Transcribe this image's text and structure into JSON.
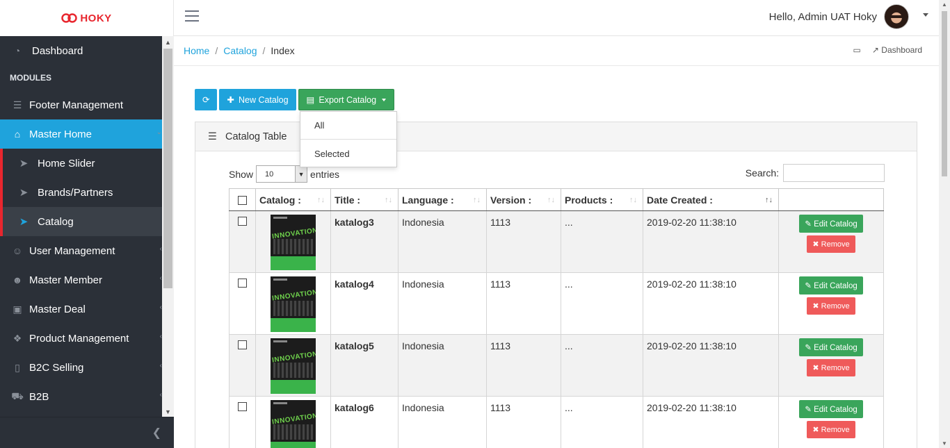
{
  "brand": {
    "name": "HOKY",
    "color": "#e8262e"
  },
  "header": {
    "greeting": "Hello, Admin UAT Hoky"
  },
  "sidebar": {
    "dashboard": "Dashboard",
    "section": "MODULES",
    "items": [
      {
        "label": "Footer Management",
        "icon": "list-icon"
      },
      {
        "label": "Master Home",
        "icon": "home-icon",
        "active": true
      },
      {
        "label": "User Management",
        "icon": "users-icon"
      },
      {
        "label": "Master Member",
        "icon": "group-icon"
      },
      {
        "label": "Master Deal",
        "icon": "money-icon"
      },
      {
        "label": "Product Management",
        "icon": "cubes-icon"
      },
      {
        "label": "B2C Selling",
        "icon": "mobile-icon"
      },
      {
        "label": "B2B",
        "icon": "cart-icon"
      }
    ],
    "subitems": [
      {
        "label": "Home Slider"
      },
      {
        "label": "Brands/Partners"
      },
      {
        "label": "Catalog",
        "selected": true
      }
    ]
  },
  "breadcrumb": {
    "home": "Home",
    "catalog": "Catalog",
    "current": "Index"
  },
  "topright": {
    "dashboard": "Dashboard"
  },
  "toolbar": {
    "new_label": "New Catalog",
    "export_label": "Export Catalog"
  },
  "export_menu": {
    "all": "All",
    "selected": "Selected"
  },
  "card": {
    "title": "Catalog Table"
  },
  "table_controls": {
    "show": "Show",
    "page_size": "10",
    "entries": "entries",
    "search": "Search:"
  },
  "table": {
    "headers": [
      "Catalog :",
      "Title :",
      "Language :",
      "Version :",
      "Products :",
      "Date Created :"
    ],
    "rows": [
      {
        "title": "katalog3",
        "language": "Indonesia",
        "version": "1113",
        "products": "...",
        "date": "2019-02-20 11:38:10"
      },
      {
        "title": "katalog4",
        "language": "Indonesia",
        "version": "1113",
        "products": "...",
        "date": "2019-02-20 11:38:10"
      },
      {
        "title": "katalog5",
        "language": "Indonesia",
        "version": "1113",
        "products": "...",
        "date": "2019-02-20 11:38:10"
      },
      {
        "title": "katalog6",
        "language": "Indonesia",
        "version": "1113",
        "products": "...",
        "date": "2019-02-20 11:38:10"
      }
    ],
    "edit_label": "Edit Catalog",
    "remove_label": "Remove",
    "thumb_text": "INNOVATION"
  }
}
